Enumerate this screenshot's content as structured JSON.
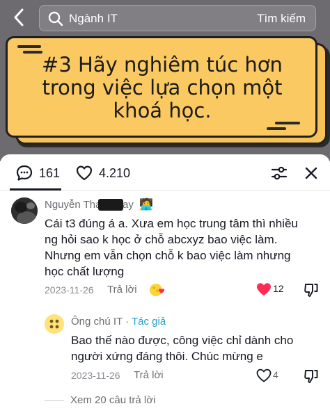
{
  "header": {
    "search_text": "Ngành IT",
    "search_button": "Tìm kiếm"
  },
  "video": {
    "card_lines": [
      "#3 Hãy nghiêm túc hơn",
      "trong việc lựa chọn một",
      "khoá học."
    ]
  },
  "sheet": {
    "comment_count": "161",
    "like_count": "4.210"
  },
  "comments": [
    {
      "author": "Nguyễn Tha",
      "author_suffix": "ay",
      "author_emoji": "🧑‍💻",
      "lines": [
        "Cái t3 đúng á a. Xưa em học trung tâm thì nhiều",
        "ng hỏi sao k học ở chỗ abcxyz bao việc làm.",
        "Nhưng em vẫn chọn chỗ k bao việc làm nhưng",
        "học chất lượng"
      ],
      "date": "2023-11-26",
      "reply_label": "Trả lời",
      "likes": "12",
      "liked": true
    },
    {
      "author": "Ông chú IT",
      "author_tag": "Tác giả",
      "separator": " · ",
      "lines": [
        "Bao thế nào được, công việc chỉ dành cho",
        "người xứng đáng thôi. Chúc mừng e"
      ],
      "date": "2023-11-26",
      "reply_label": "Trả lời",
      "likes": "4",
      "liked": false
    }
  ],
  "view_more": "Xem 20 câu trả lời",
  "colors": {
    "like_red": "#fe2c55",
    "author_tag": "#23a0c8",
    "card_yellow": "#fbc961"
  }
}
